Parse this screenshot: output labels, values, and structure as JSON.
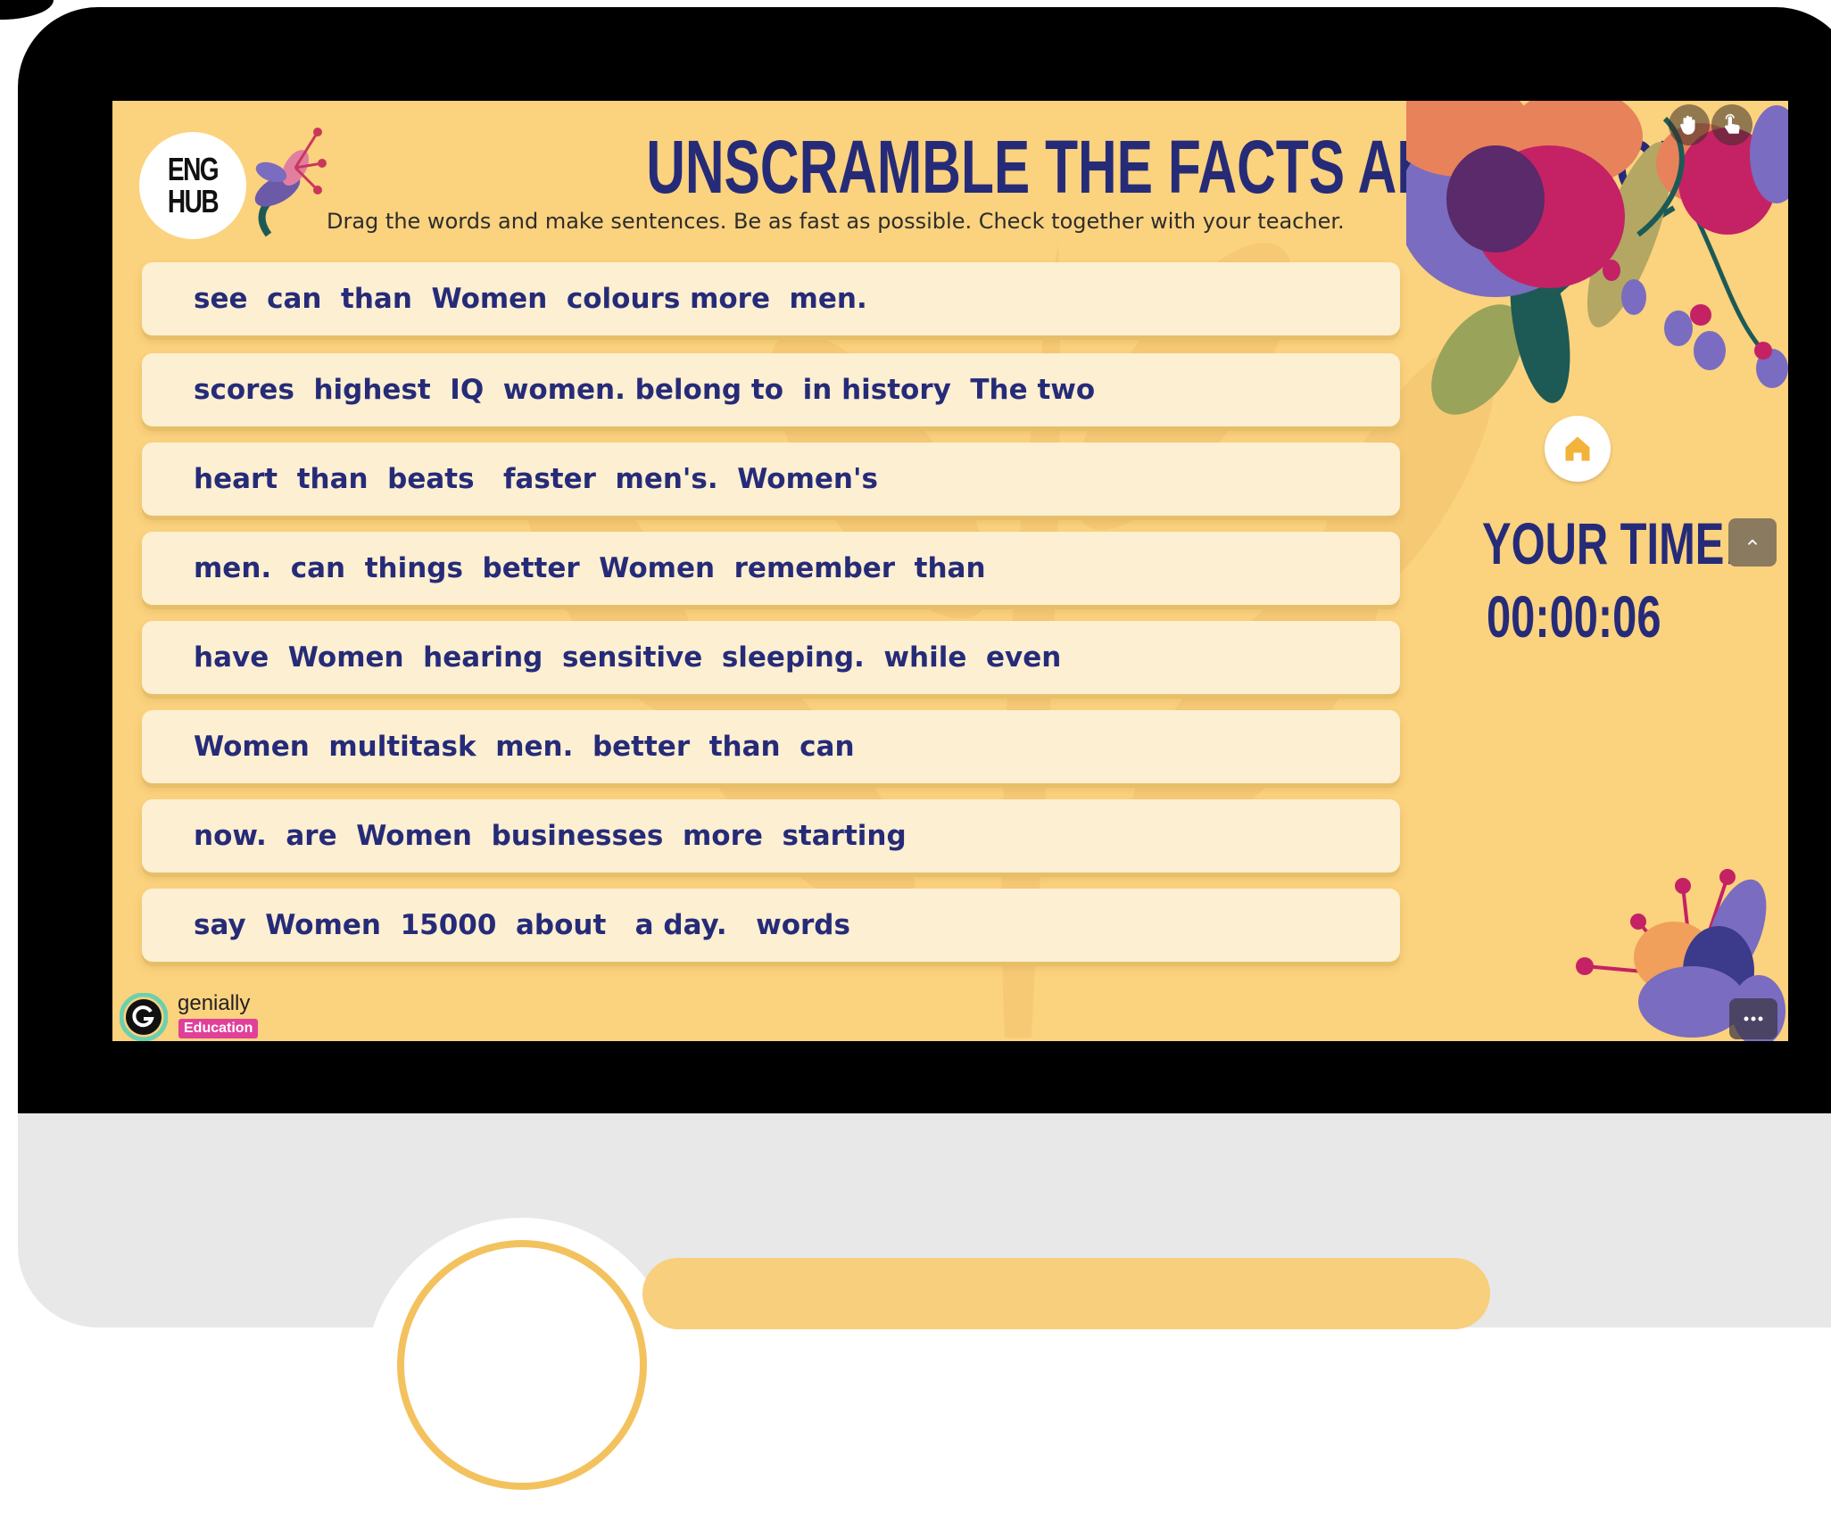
{
  "logo": {
    "line1": "ENG",
    "line2": "HUB"
  },
  "header": {
    "title": "UNSCRAMBLE THE FACTS ABOUT WOMEN",
    "subtitle": "Drag the words and make sentences. Be as fast as possible. Check together with your teacher."
  },
  "sentences": [
    "see  can  than  Women  colours more  men.",
    "scores  highest  IQ  women. belong to  in history  The two",
    "heart  than  beats   faster  men's.  Women's",
    "men.  can  things  better  Women  remember  than",
    "have  Women  hearing  sensitive  sleeping.  while  even",
    "Women  multitask  men.  better  than  can",
    "now.  are  Women  businesses  more  starting",
    "say  Women  15000  about   a day.   words"
  ],
  "timer": {
    "label": "YOUR TIME:",
    "value": "00:00:06"
  },
  "controls": {
    "hand_icon": "hand-icon",
    "pointer_icon": "pointer-icon",
    "home_icon": "home-icon",
    "collapse_glyph": "^",
    "more_glyph": "•••"
  },
  "badge": {
    "name": "genially",
    "tag": "Education"
  },
  "colors": {
    "background": "#fbd27e",
    "text": "#262b78",
    "card": "#fcefd2",
    "bezel": "#000000"
  }
}
